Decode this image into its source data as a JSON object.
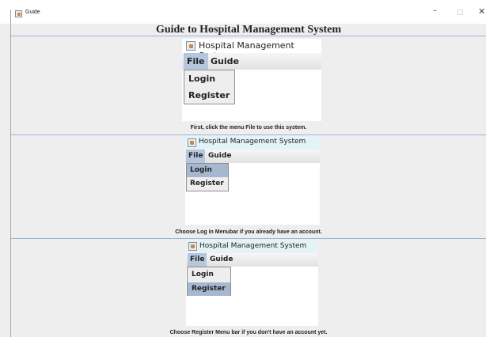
{
  "window": {
    "title": "Guide",
    "minimize_glyph": "–",
    "maximize_glyph": "□",
    "close_glyph": "✕"
  },
  "heading": "Guide to Hospital Management System",
  "panels": [
    {
      "title": "Hospital Management System",
      "menus": [
        "File",
        "Guide"
      ],
      "dropdown_items": [
        "Login",
        "Register"
      ],
      "highlighted_item": null,
      "caption": "First, click the menu File to use this system."
    },
    {
      "title": "Hospital Management System",
      "menus": [
        "File",
        "Guide"
      ],
      "dropdown_items": [
        "Login",
        "Register"
      ],
      "highlighted_item": "Login",
      "caption": "Choose Log in Menubar if you already have an account."
    },
    {
      "title": "Hospital Management System",
      "menus": [
        "File",
        "Guide"
      ],
      "dropdown_items": [
        "Login",
        "Register"
      ],
      "highlighted_item": "Register",
      "caption": "Choose Register Menu bar if you don't have an account yet."
    }
  ],
  "colors": {
    "selected_menu_bg": "#b5c7dd",
    "highlight_bg": "#a6b8d0",
    "panel_titlebar_highlight": "#e4f3f7"
  }
}
